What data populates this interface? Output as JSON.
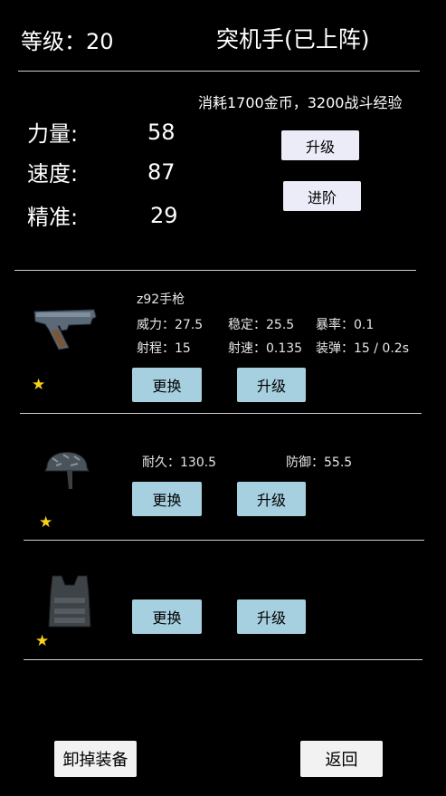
{
  "header": {
    "level_label": "等级：",
    "level_value": "20",
    "role_name": "突机手(已上阵)"
  },
  "upgrade": {
    "cost_text": "消耗1700金币，3200战斗经验",
    "upgrade_button": "升级",
    "advance_button": "进阶"
  },
  "stats": [
    {
      "label": "力量:",
      "value": "58"
    },
    {
      "label": "速度:",
      "value": "87"
    },
    {
      "label": "精准:",
      "value": "29"
    }
  ],
  "weapon": {
    "name": "z92手枪",
    "attrs": [
      {
        "label": "威力：",
        "value": "27.5"
      },
      {
        "label": "稳定：",
        "value": "25.5"
      },
      {
        "label": "暴率：",
        "value": "0.1"
      },
      {
        "label": "射程：",
        "value": "15"
      },
      {
        "label": "射速：",
        "value": "0.135"
      },
      {
        "label": "装弹：",
        "value": "15 / 0.2s"
      }
    ],
    "replace_button": "更换",
    "upgrade_button": "升级",
    "star": "★",
    "icon": "pistol-icon"
  },
  "helmet": {
    "attrs": [
      {
        "label": "耐久：",
        "value": "130.5"
      },
      {
        "label": "防御：",
        "value": "55.5"
      }
    ],
    "replace_button": "更换",
    "upgrade_button": "升级",
    "star": "★",
    "icon": "helmet-icon"
  },
  "vest": {
    "replace_button": "更换",
    "upgrade_button": "升级",
    "star": "★",
    "icon": "vest-icon"
  },
  "footer": {
    "unequip_button": "卸掉装备",
    "back_button": "返回"
  },
  "colors": {
    "background": "#000000",
    "lavender_button": "#ececf8",
    "blue_button": "#a6d0e0",
    "star": "#f7d21b"
  }
}
